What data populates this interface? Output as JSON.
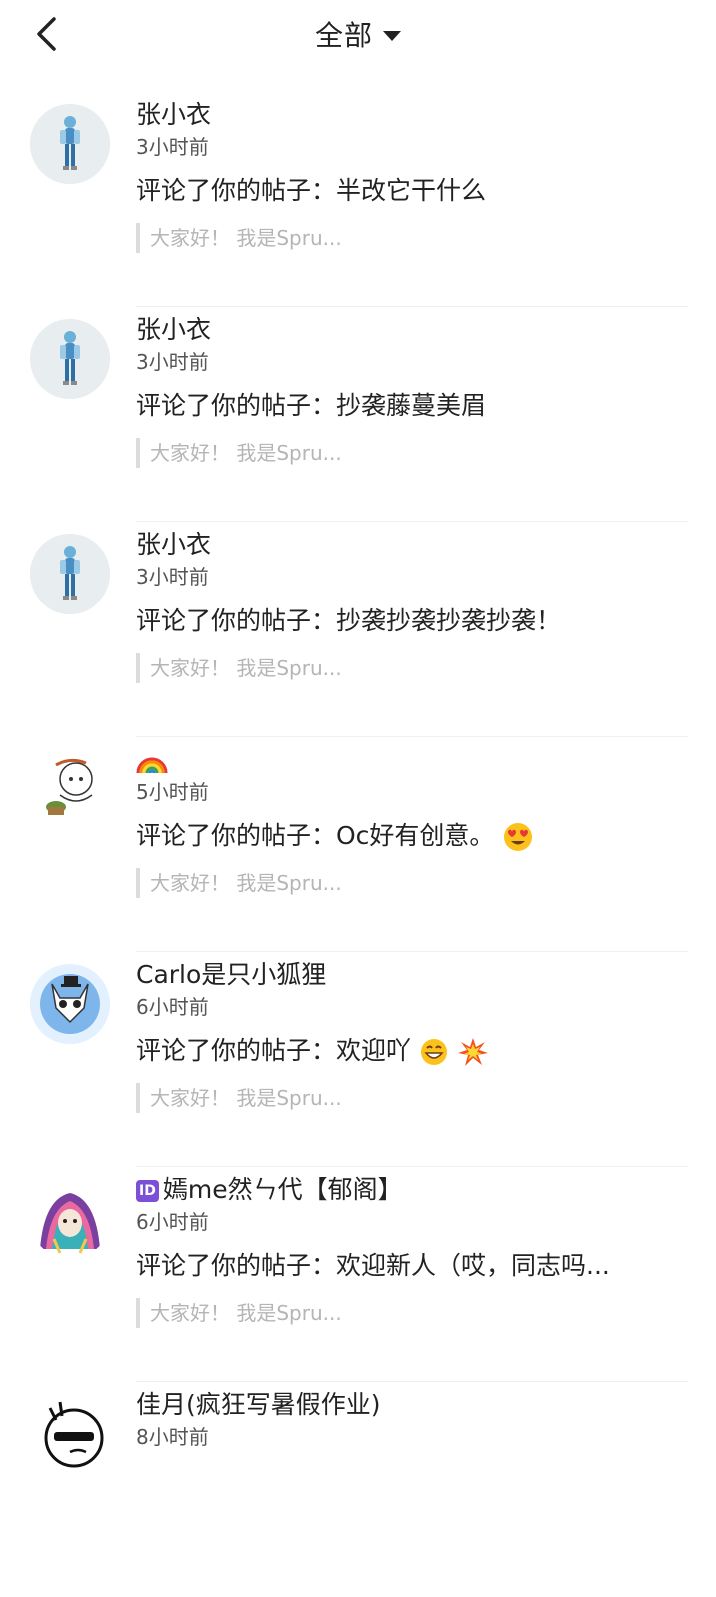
{
  "header": {
    "title": "全部",
    "back_icon": "chevron-left-icon",
    "dropdown_icon": "caret-down-icon"
  },
  "notifications": [
    {
      "username": "张小衣",
      "time": "3小时前",
      "comment": "评论了你的帖子：半改它干什么",
      "quote": "大家好！ 我是Spru..."
    },
    {
      "username": "张小衣",
      "time": "3小时前",
      "comment": "评论了你的帖子：抄袭藤蔓美眉",
      "quote": "大家好！ 我是Spru..."
    },
    {
      "username": "张小衣",
      "time": "3小时前",
      "comment": "评论了你的帖子：抄袭抄袭抄袭抄袭！",
      "quote": "大家好！ 我是Spru..."
    },
    {
      "username": "",
      "username_emoji": "rainbow",
      "time": "5小时前",
      "comment": "评论了你的帖子：Oc好有创意。",
      "comment_emoji": "heart-eyes",
      "quote": "大家好！ 我是Spru..."
    },
    {
      "username": "Carlo是只小狐狸",
      "time": "6小时前",
      "comment": "评论了你的帖子：欢迎吖",
      "comment_emoji": "grin-collision",
      "quote": "大家好！ 我是Spru..."
    },
    {
      "username": "嫣me然ㄣ代【郁阁】",
      "username_badge": "ID",
      "time": "6小时前",
      "comment": "评论了你的帖子：欢迎新人（哎，同志吗...",
      "quote": "大家好！ 我是Spru..."
    },
    {
      "username": "佳月(疯狂写暑假作业)",
      "time": "8小时前",
      "comment": "",
      "quote": ""
    }
  ]
}
